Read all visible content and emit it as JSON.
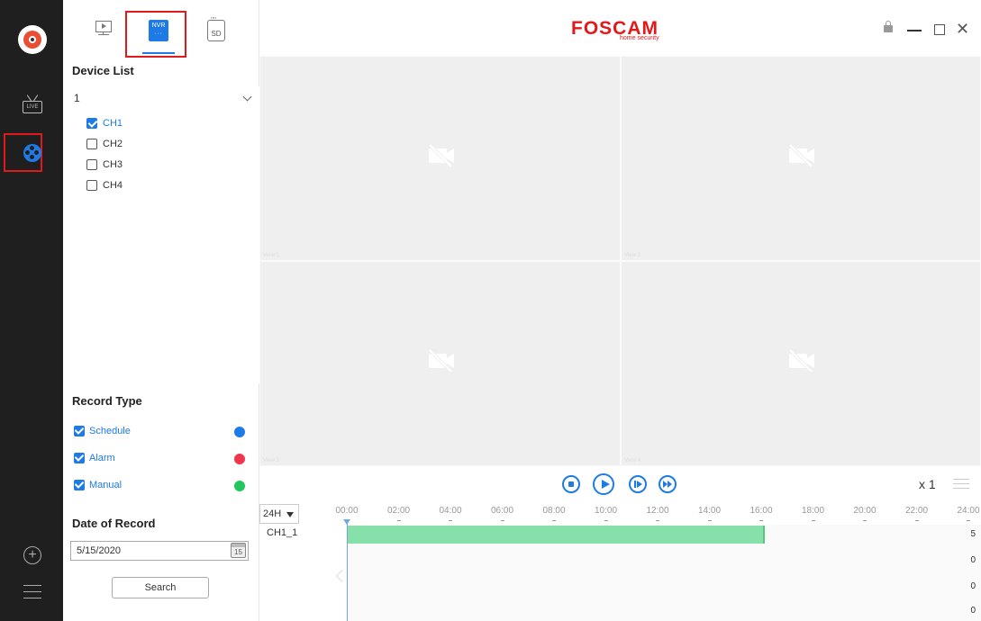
{
  "window": {
    "brand": "FOSCAM",
    "brand_sub": "home security"
  },
  "rail": {
    "live_label": "LIVE"
  },
  "tabs": {
    "nvr_label": "NVR",
    "sd_label": "SD"
  },
  "device_list": {
    "title": "Device List",
    "device": "1",
    "channels": [
      {
        "label": "CH1",
        "checked": true
      },
      {
        "label": "CH2",
        "checked": false
      },
      {
        "label": "CH3",
        "checked": false
      },
      {
        "label": "CH4",
        "checked": false
      }
    ]
  },
  "record_type": {
    "title": "Record Type",
    "items": [
      {
        "label": "Schedule",
        "color": "#1e7be6"
      },
      {
        "label": "Alarm",
        "color": "#f0364d"
      },
      {
        "label": "Manual",
        "color": "#22c55e"
      }
    ]
  },
  "date_of_record": {
    "title": "Date of Record",
    "value": "5/15/2020",
    "calendar_day": "15",
    "search_label": "Search"
  },
  "views": [
    "View 1",
    "View 2",
    "View 3",
    "View 4"
  ],
  "playback": {
    "speed": "x 1"
  },
  "timeline": {
    "range": "24H",
    "ticks": [
      "00:00",
      "02:00",
      "04:00",
      "06:00",
      "08:00",
      "10:00",
      "12:00",
      "14:00",
      "16:00",
      "18:00",
      "20:00",
      "22:00",
      "24:00"
    ],
    "track_label": "CH1_1",
    "recording": {
      "start_hour": 0,
      "end_hour": 16.1
    },
    "counts": [
      "5",
      "0",
      "0",
      "0"
    ]
  },
  "colors": {
    "accent": "#1e7be6",
    "highlight": "#e0191b",
    "recording": "#86e0a9"
  }
}
